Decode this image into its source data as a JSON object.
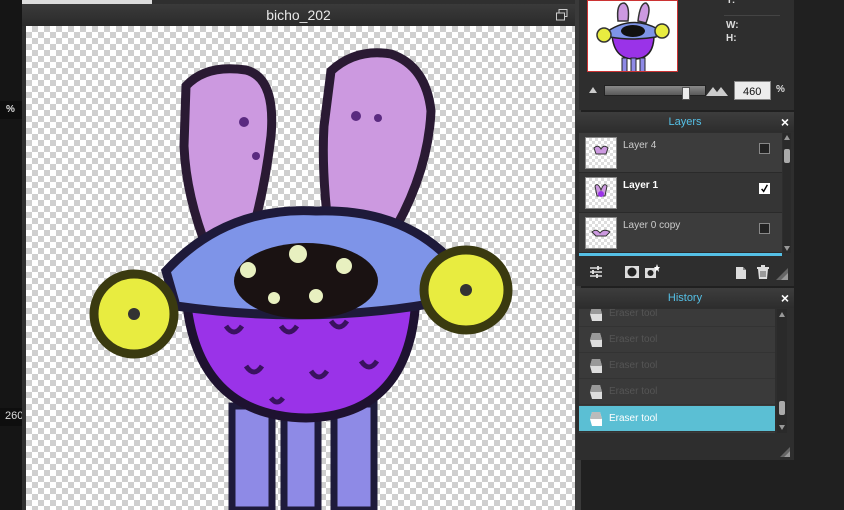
{
  "left_strip": {
    "zoom_percent_sign": "%",
    "zoom_value": "260"
  },
  "document": {
    "title": "bicho_202"
  },
  "navigator": {
    "y_label": "Y:",
    "w_label": "W:",
    "h_label": "H:",
    "zoom_value": "460",
    "zoom_unit": "%",
    "zoom_fraction": 0.75
  },
  "layers": {
    "title": "Layers",
    "close_glyph": "×",
    "items": [
      {
        "name": "Layer 4",
        "visible": false,
        "selected": false
      },
      {
        "name": "Layer 1",
        "visible": true,
        "selected": true
      },
      {
        "name": "Layer 0 copy",
        "visible": false,
        "selected": false
      }
    ],
    "tool_icons": [
      "layer-settings-icon",
      "mask-icon",
      "effects-icon",
      "new-layer-icon",
      "delete-layer-icon"
    ]
  },
  "history": {
    "title": "History",
    "close_glyph": "×",
    "items": [
      {
        "label": "Eraser tool",
        "selected": false
      },
      {
        "label": "Eraser tool",
        "selected": false
      },
      {
        "label": "Eraser tool",
        "selected": false
      },
      {
        "label": "Eraser tool",
        "selected": false
      },
      {
        "label": "Eraser tool",
        "selected": true
      }
    ]
  },
  "colors": {
    "accent": "#55c0e6",
    "history_selected": "#5bbfd4"
  }
}
